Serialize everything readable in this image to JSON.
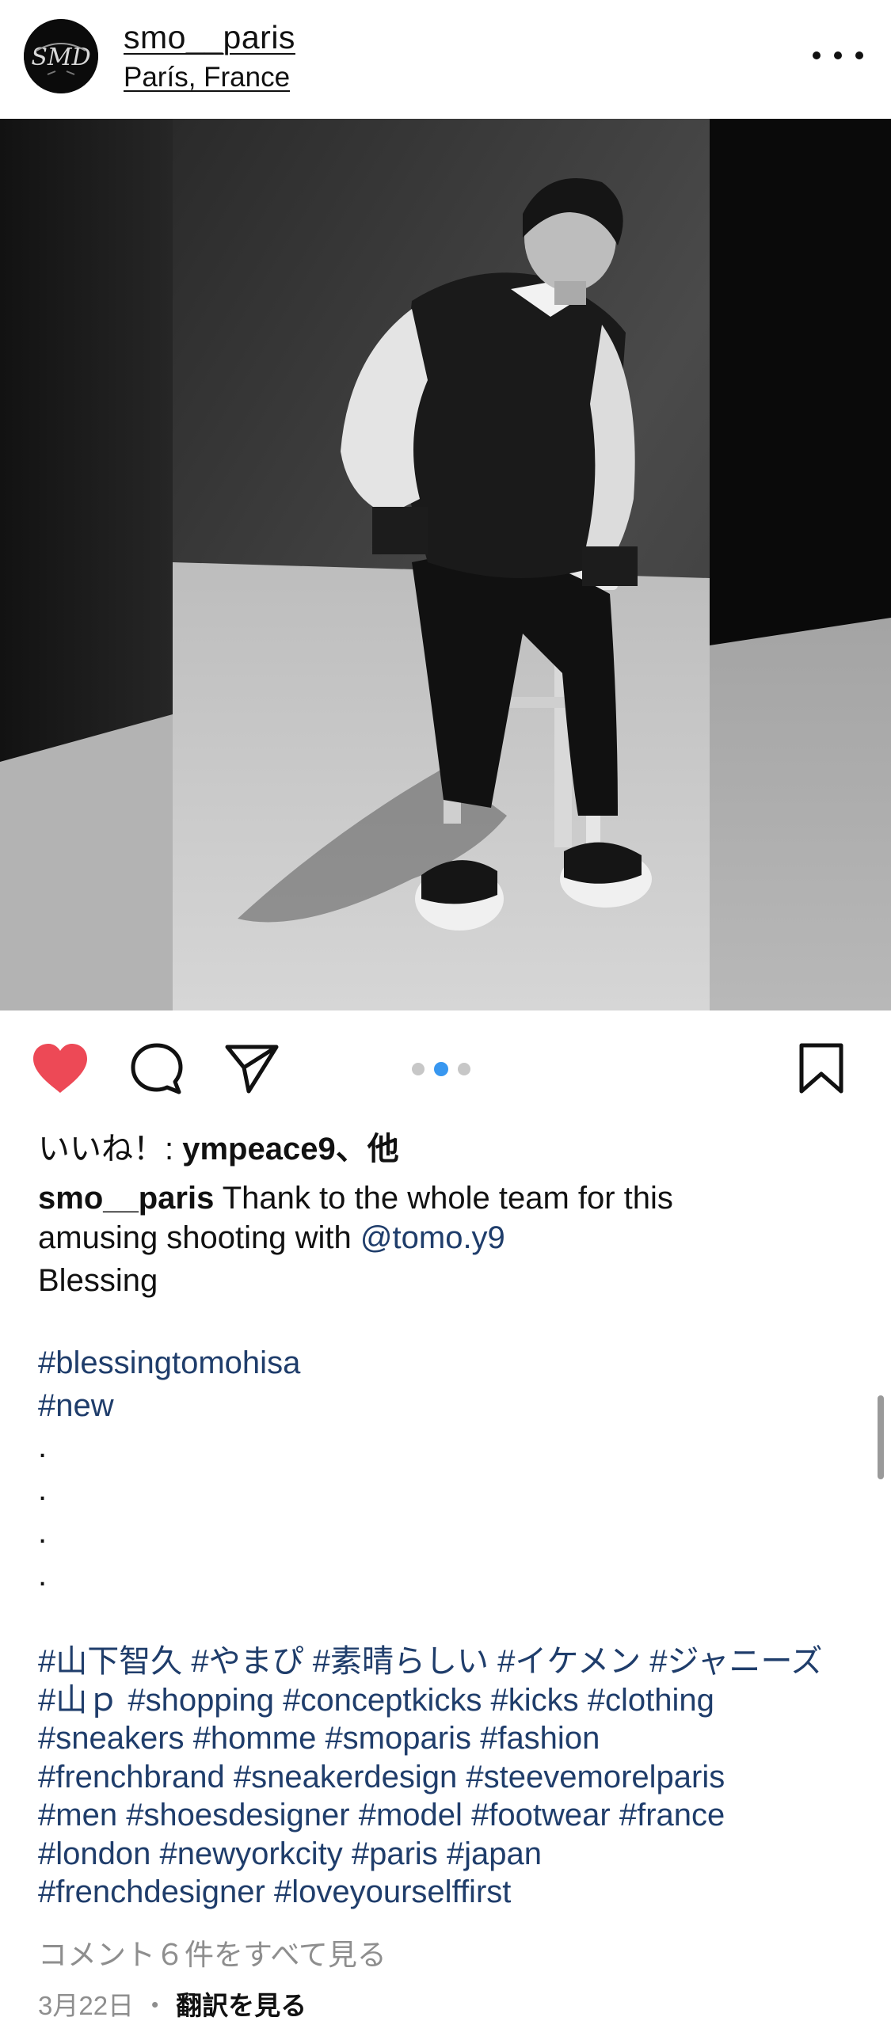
{
  "header": {
    "username": "smo__paris",
    "location": "París, France",
    "avatar_text": "SMD"
  },
  "post": {
    "image_alt": "photo",
    "carousel": {
      "count": 3,
      "active_index": 2
    }
  },
  "actions": {
    "like_icon": "heart-filled-icon",
    "comment_icon": "comment-bubble-icon",
    "share_icon": "paper-plane-icon",
    "save_icon": "bookmark-icon",
    "like_color": "#ed4956"
  },
  "likes": {
    "prefix": "いいね！: ",
    "user": "ympeace9、他"
  },
  "caption": {
    "author": "smo__paris",
    "line1_rest": " Thank to the whole team for this",
    "line2_text": "amusing shooting with ",
    "mention": "@tomo.y9",
    "line3": "Blessing",
    "tag_blessing": "#blessingtomohisa",
    "tag_new": "#new",
    "dots": [
      ".",
      ".",
      ".",
      "."
    ]
  },
  "hashtags": [
    "#山下智久",
    "#やまぴ",
    "#素晴らしい",
    "#イケメン",
    "#ジャニーズ",
    "#山ｐ",
    "#shopping",
    "#conceptkicks",
    "#kicks",
    "#clothing",
    "#sneakers",
    "#homme",
    "#smoparis",
    "#fashion",
    "#frenchbrand",
    "#sneakerdesign",
    "#steevemorelparis",
    "#men",
    "#shoesdesigner",
    "#model",
    "#footwear",
    "#france",
    "#london",
    "#newyorkcity",
    "#paris",
    "#japan",
    "#frenchdesigner",
    "#loveyourselffirst"
  ],
  "comments": {
    "view_all": "コメント６件をすべて見る"
  },
  "meta": {
    "date": "3月22日",
    "separator": "・",
    "translate": "翻訳を見る"
  }
}
